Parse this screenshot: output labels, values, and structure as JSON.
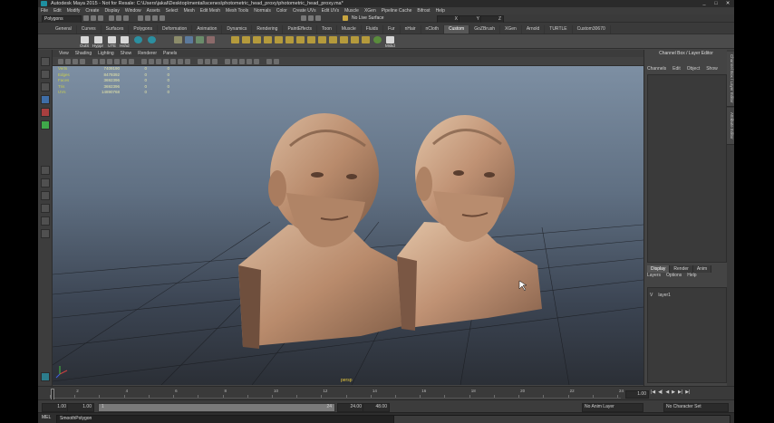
{
  "window": {
    "title": "Autodesk Maya 2015 - Not for Resale: C:\\Users\\jakal\\Desktop\\mental\\scenes\\photometric_head_proxy\\photometric_head_proxy.ma*",
    "controls": [
      "_",
      "□",
      "✕"
    ]
  },
  "menubar": [
    "File",
    "Edit",
    "Modify",
    "Create",
    "Display",
    "Window",
    "Assets",
    "Select",
    "Mesh",
    "Edit Mesh",
    "Mesh Tools",
    "Normals",
    "Color",
    "Create UVs",
    "Edit UVs",
    "Muscle",
    "XGen",
    "Pipeline Cache",
    "Bifrost",
    "Help"
  ],
  "statusline": {
    "mode": "Polygons",
    "live_surface": "No Live Surface",
    "fields": [
      "X",
      "Y",
      "Z"
    ]
  },
  "shelf": {
    "tabs": [
      "General",
      "Curves",
      "Surfaces",
      "Polygons",
      "Deformation",
      "Animation",
      "Dynamics",
      "Rendering",
      "PaintEffects",
      "Toon",
      "Muscle",
      "Fluids",
      "Fur",
      "nHair",
      "nCloth",
      "Custom",
      "GoZBrush",
      "XGen",
      "Arnold",
      "TURTLE",
      "Custom30670"
    ],
    "active_tab": "Custom",
    "icon_labels": [
      "OutS",
      "Hyppr",
      "UTE",
      "Hshd",
      "Mskd"
    ]
  },
  "panel": {
    "menus": [
      "View",
      "Shading",
      "Lighting",
      "Show",
      "Renderer",
      "Panels"
    ],
    "camera": "persp"
  },
  "hud": {
    "rows": [
      {
        "label": "Verts",
        "a": "7409190",
        "b": "0",
        "c": "0"
      },
      {
        "label": "Edges",
        "a": "8479392",
        "b": "0",
        "c": "0"
      },
      {
        "label": "Faces",
        "a": "3692396",
        "b": "0",
        "c": "0"
      },
      {
        "label": "Tris",
        "a": "3692396",
        "b": "0",
        "c": "0"
      },
      {
        "label": "UVs",
        "a": "14890768",
        "b": "0",
        "c": "0"
      }
    ]
  },
  "channel_box": {
    "title": "Channel Box / Layer Editor",
    "menus": [
      "Channels",
      "Edit",
      "Object",
      "Show"
    ],
    "layer_tabs": [
      "Display",
      "Render",
      "Anim"
    ],
    "active_layer_tab": "Display",
    "layer_menus": [
      "Layers",
      "Options",
      "Help"
    ],
    "layer": {
      "visibility": "V",
      "name": "layer1"
    }
  },
  "side_tabs": [
    "Channel Box / Layer Editor",
    "Attribute Editor"
  ],
  "timeline": {
    "tick_labels": [
      "1",
      "2",
      "4",
      "6",
      "8",
      "10",
      "12",
      "14",
      "16",
      "18",
      "20",
      "22",
      "24"
    ],
    "current_frame": "1.00",
    "controls": [
      "|◀",
      "◀|",
      "◀",
      "▶",
      "▶|",
      "▶|"
    ]
  },
  "range": {
    "start": "1.00",
    "start2": "1.00",
    "range_start": "1",
    "range_end": "24",
    "end": "24.00",
    "end2": "48.00",
    "anim_layer": "No Anim Layer",
    "char_set": "No Character Set"
  },
  "command": {
    "label": "MEL",
    "input": "SmoothPolygon"
  }
}
